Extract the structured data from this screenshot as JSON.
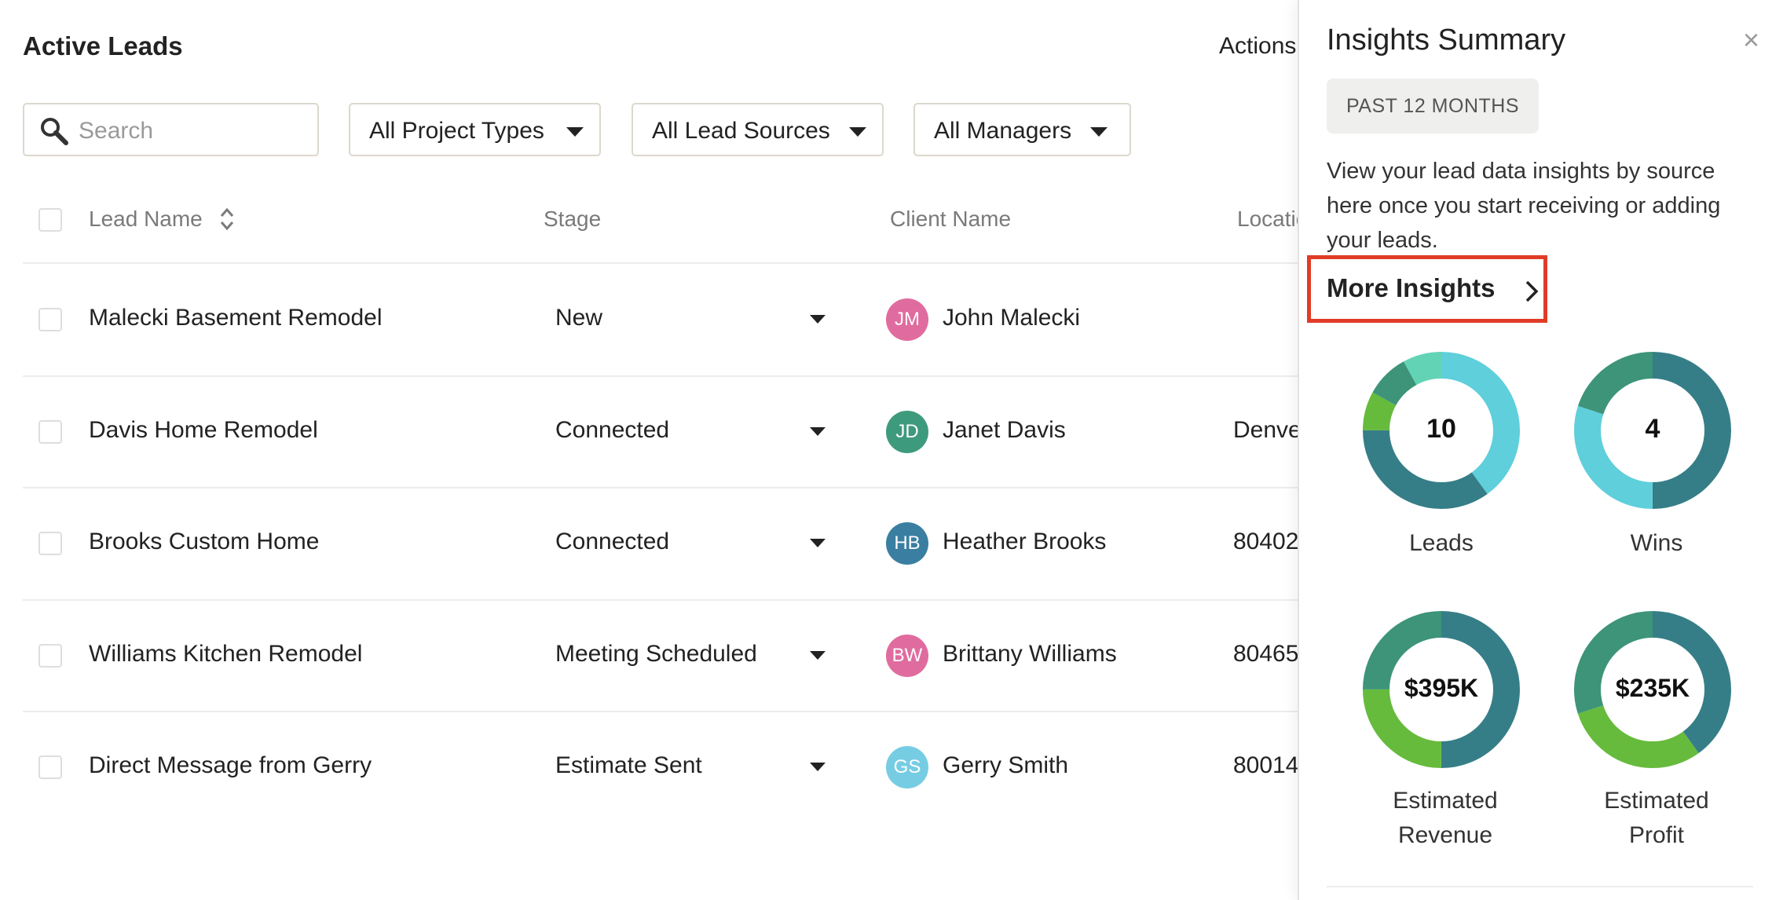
{
  "page": {
    "title": "Active Leads",
    "actions_label": "Actions"
  },
  "search": {
    "placeholder": "Search"
  },
  "filters": [
    {
      "label": "All Project Types"
    },
    {
      "label": "All Lead Sources"
    },
    {
      "label": "All Managers"
    }
  ],
  "table": {
    "headers": {
      "lead_name": "Lead Name",
      "stage": "Stage",
      "client_name": "Client Name",
      "location": "Locatio"
    },
    "rows": [
      {
        "lead": "Malecki Basement Remodel",
        "stage": "New",
        "initials": "JM",
        "avatar_color": "#e06c9f",
        "client": "John Malecki",
        "location": ""
      },
      {
        "lead": "Davis Home Remodel",
        "stage": "Connected",
        "initials": "JD",
        "avatar_color": "#3e9a7c",
        "client": "Janet Davis",
        "location": "Denve"
      },
      {
        "lead": "Brooks Custom Home",
        "stage": "Connected",
        "initials": "HB",
        "avatar_color": "#3a7fa1",
        "client": "Heather Brooks",
        "location": "80402"
      },
      {
        "lead": "Williams Kitchen Remodel",
        "stage": "Meeting Scheduled",
        "initials": "BW",
        "avatar_color": "#e06c9f",
        "client": "Brittany Williams",
        "location": "80465"
      },
      {
        "lead": "Direct Message from Gerry",
        "stage": "Estimate Sent",
        "initials": "GS",
        "avatar_color": "#76cde3",
        "client": "Gerry Smith",
        "location": "80014"
      }
    ]
  },
  "insights": {
    "title": "Insights Summary",
    "close_icon": "×",
    "period": "PAST 12 MONTHS",
    "description": "View your lead data insights by source here once you start receiving or adding your leads.",
    "more_label": "More Insights",
    "highlight_color": "#e03c27",
    "cards": [
      {
        "value": "10",
        "label": "Leads",
        "segments": [
          {
            "fraction": 0.4,
            "color": "#5ecfdb"
          },
          {
            "fraction": 0.35,
            "color": "#367e87"
          },
          {
            "fraction": 0.08,
            "color": "#66bb3d"
          },
          {
            "fraction": 0.09,
            "color": "#3d9479"
          },
          {
            "fraction": 0.08,
            "color": "#63d3b6"
          }
        ]
      },
      {
        "value": "4",
        "label": "Wins",
        "segments": [
          {
            "fraction": 0.5,
            "color": "#367e87"
          },
          {
            "fraction": 0.3,
            "color": "#5ecfdb"
          },
          {
            "fraction": 0.2,
            "color": "#3d9479"
          }
        ]
      },
      {
        "value": "$395K",
        "label": "Estimated Revenue",
        "segments": [
          {
            "fraction": 0.5,
            "color": "#367e87"
          },
          {
            "fraction": 0.25,
            "color": "#66bb3d"
          },
          {
            "fraction": 0.25,
            "color": "#3d9479"
          }
        ]
      },
      {
        "value": "$235K",
        "label": "Estimated Profit",
        "segments": [
          {
            "fraction": 0.4,
            "color": "#367e87"
          },
          {
            "fraction": 0.3,
            "color": "#66bb3d"
          },
          {
            "fraction": 0.3,
            "color": "#3d9479"
          }
        ]
      }
    ]
  }
}
